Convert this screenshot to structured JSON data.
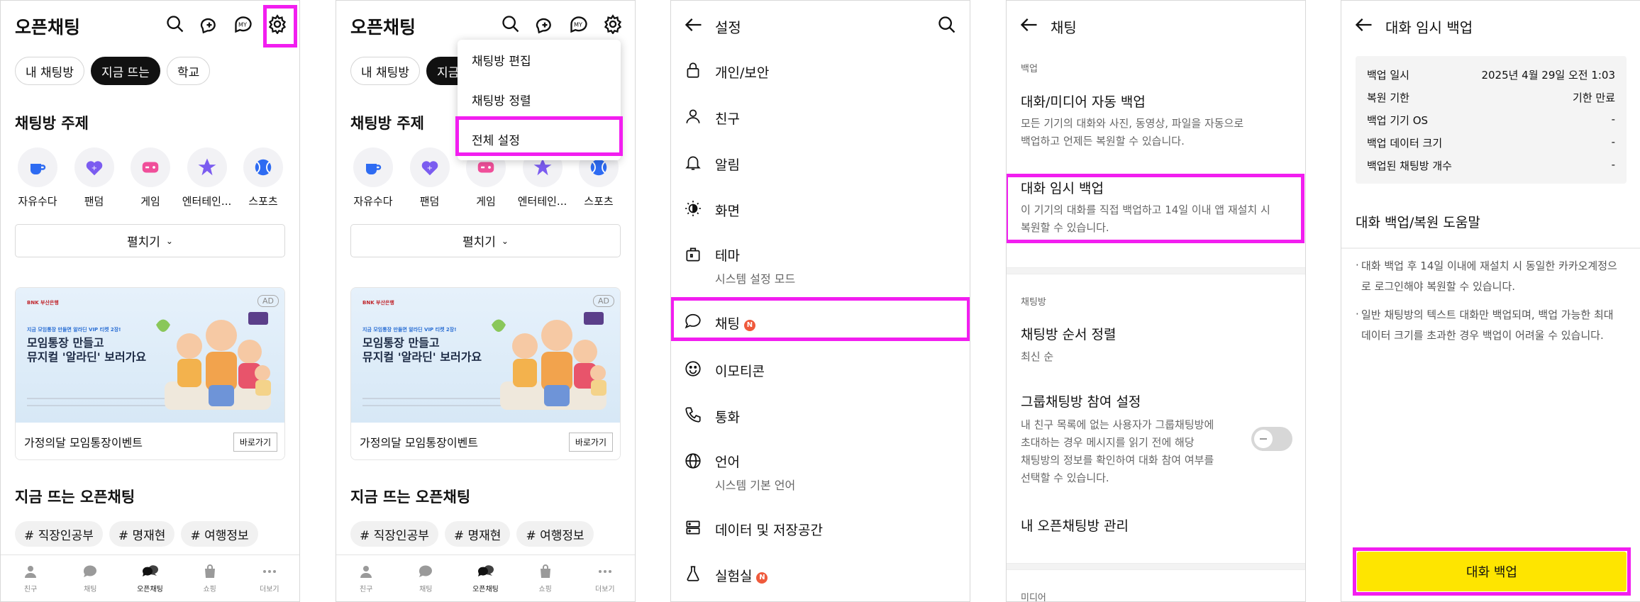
{
  "open_chat": {
    "title": "오픈채팅",
    "tabs": [
      "내 채팅방",
      "지금 뜨는",
      "학교"
    ],
    "topics_title": "채팅방 주제",
    "topics": [
      "자유수다",
      "팬덤",
      "게임",
      "엔터테인...",
      "스포츠"
    ],
    "expand_label": "펼치기",
    "ad": {
      "badge": "AD",
      "bank": "BNK 부산은행",
      "small_text": "지금 모임통장 만들면 알라딘 VIP 티켓 2장!",
      "headline_1": "모임통장 만들고",
      "headline_2": "뮤지컬 '알라딘' 보러가요",
      "footer_text": "가정의달 모임통장이벤트",
      "button": "바로가기"
    },
    "trending_title": "지금 뜨는 오픈채팅",
    "tags": [
      "# 직장인공부",
      "# 명재현",
      "# 여행정보"
    ],
    "nav": [
      "친구",
      "채팅",
      "오픈채팅",
      "쇼핑",
      "더보기"
    ],
    "active_nav": "오픈채팅",
    "dropdown": [
      "채팅방 편집",
      "채팅방 정렬",
      "전체 설정"
    ]
  },
  "settings": {
    "title": "설정",
    "items": [
      {
        "label": "개인/보안",
        "icon": "lock-icon"
      },
      {
        "label": "친구",
        "icon": "person-icon"
      },
      {
        "label": "알림",
        "icon": "bell-icon"
      },
      {
        "label": "화면",
        "icon": "brightness-icon"
      },
      {
        "label": "테마",
        "sub": "시스템 설정 모드",
        "icon": "theme-icon"
      },
      {
        "label": "채팅",
        "badge": "N",
        "icon": "chat-bubble-icon"
      },
      {
        "label": "이모티콘",
        "icon": "smile-icon"
      },
      {
        "label": "통화",
        "icon": "phone-icon"
      },
      {
        "label": "언어",
        "sub": "시스템 기본 언어",
        "icon": "globe-icon"
      },
      {
        "label": "데이터 및 저장공간",
        "icon": "storage-icon"
      },
      {
        "label": "실험실",
        "badge": "N",
        "icon": "flask-icon"
      }
    ]
  },
  "chat_settings": {
    "title": "채팅",
    "sec_backup": "백업",
    "auto_backup_title": "대화/미디어 자동 백업",
    "auto_backup_desc_1": "모든 기기의 대화와 사진, 동영상, 파일을 자동으로",
    "auto_backup_desc_2": "백업하고 언제든 복원할 수 있습니다.",
    "temp_backup_title": "대화 임시 백업",
    "temp_backup_desc_1": "이 기기의 대화를 직접 백업하고 14일 이내 앱 재설치 시",
    "temp_backup_desc_2": "복원할 수 있습니다.",
    "sec_chatroom": "채팅방",
    "order_title": "채팅방 순서 정렬",
    "order_value": "최신 순",
    "group_title": "그룹채팅방 참여 설정",
    "group_desc": [
      "내 친구 목록에 없는 사용자가 그룹채팅방에",
      "초대하는 경우 메시지를 읽기 전에 해당",
      "채팅방의 정보를 확인하여 대화 참여 여부를",
      "선택할 수 있습니다."
    ],
    "group_toggle": "off",
    "manage_title": "내 오픈채팅방 관리",
    "sec_media": "미디어"
  },
  "temp_backup": {
    "title": "대화 임시 백업",
    "rows": [
      {
        "label": "백업 일시",
        "value": "2025년 4월 29일 오전 1:03"
      },
      {
        "label": "복원 기한",
        "value": "기한 만료"
      },
      {
        "label": "백업 기기 OS",
        "value": "-"
      },
      {
        "label": "백업 데이터 크기",
        "value": "-"
      },
      {
        "label": "백업된 채팅방 개수",
        "value": "-"
      }
    ],
    "help_title": "대화 백업/복원 도움말",
    "notes": [
      "대화 백업 후 14일 이내에 재설치 시 동일한 카카오계정으로 로그인해야 복원할 수 있습니다.",
      "일반 채팅방의 텍스트 대화만 백업되며, 백업 가능한 최대 데이터 크기를 초과한 경우 백업이 어려울 수 있습니다."
    ],
    "button": "대화 백업"
  },
  "colors": {
    "highlight": "#f21ef0",
    "cta": "#fee500",
    "badge": "#ef5a3c",
    "topic_accent": "#7b5cf0"
  }
}
